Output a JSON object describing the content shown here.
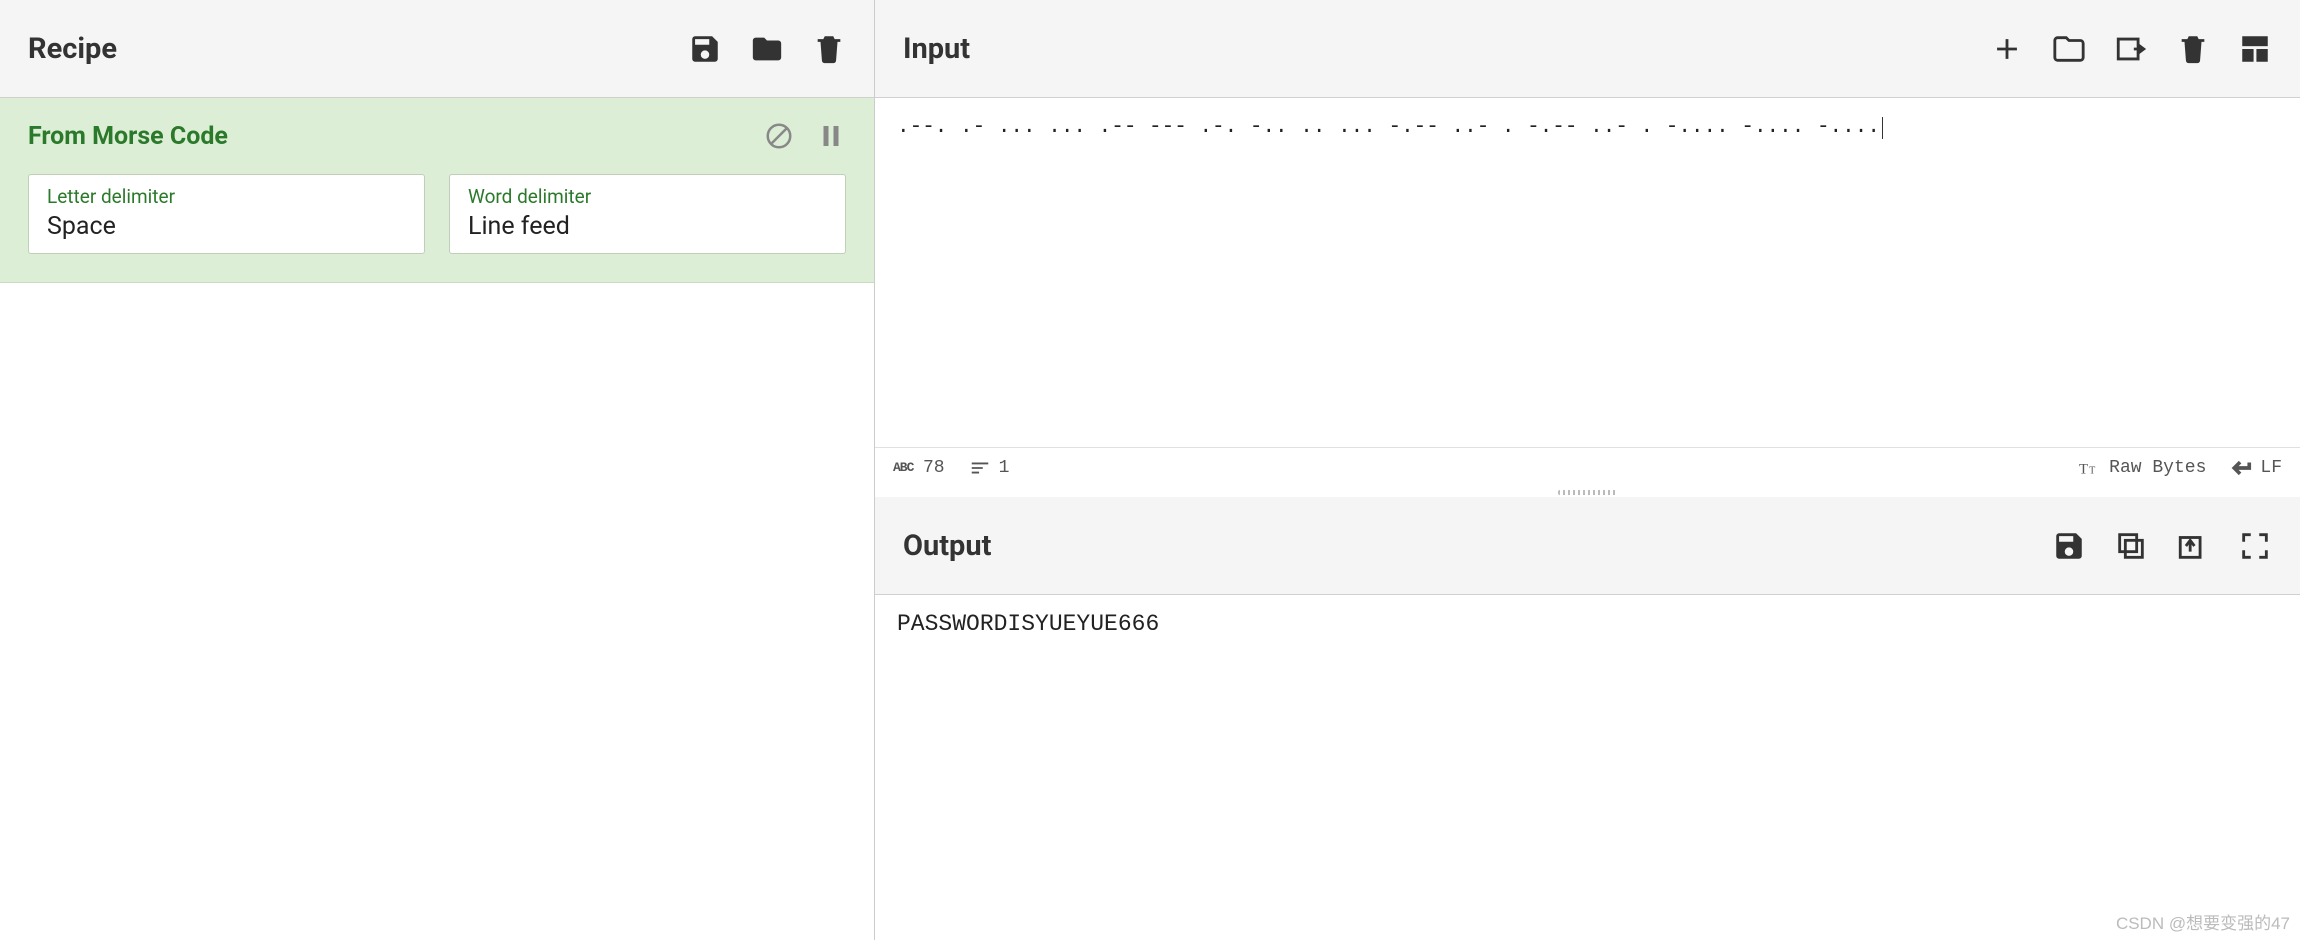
{
  "recipe": {
    "title": "Recipe",
    "operation": {
      "name": "From Morse Code",
      "args": {
        "letter_delim_label": "Letter delimiter",
        "letter_delim_value": "Space",
        "word_delim_label": "Word delimiter",
        "word_delim_value": "Line feed"
      }
    }
  },
  "input": {
    "title": "Input",
    "content": ".--. .- ... ... .-- --- .-. -.. .. ... -.-- ..- . -.-- ..- . -.... -.... -....",
    "status": {
      "char_count": "78",
      "line_count": "1",
      "encoding": "Raw Bytes",
      "eol": "LF"
    }
  },
  "output": {
    "title": "Output",
    "content": "PASSWORDISYUEYUE666"
  },
  "watermark": "CSDN @想要变强的47"
}
